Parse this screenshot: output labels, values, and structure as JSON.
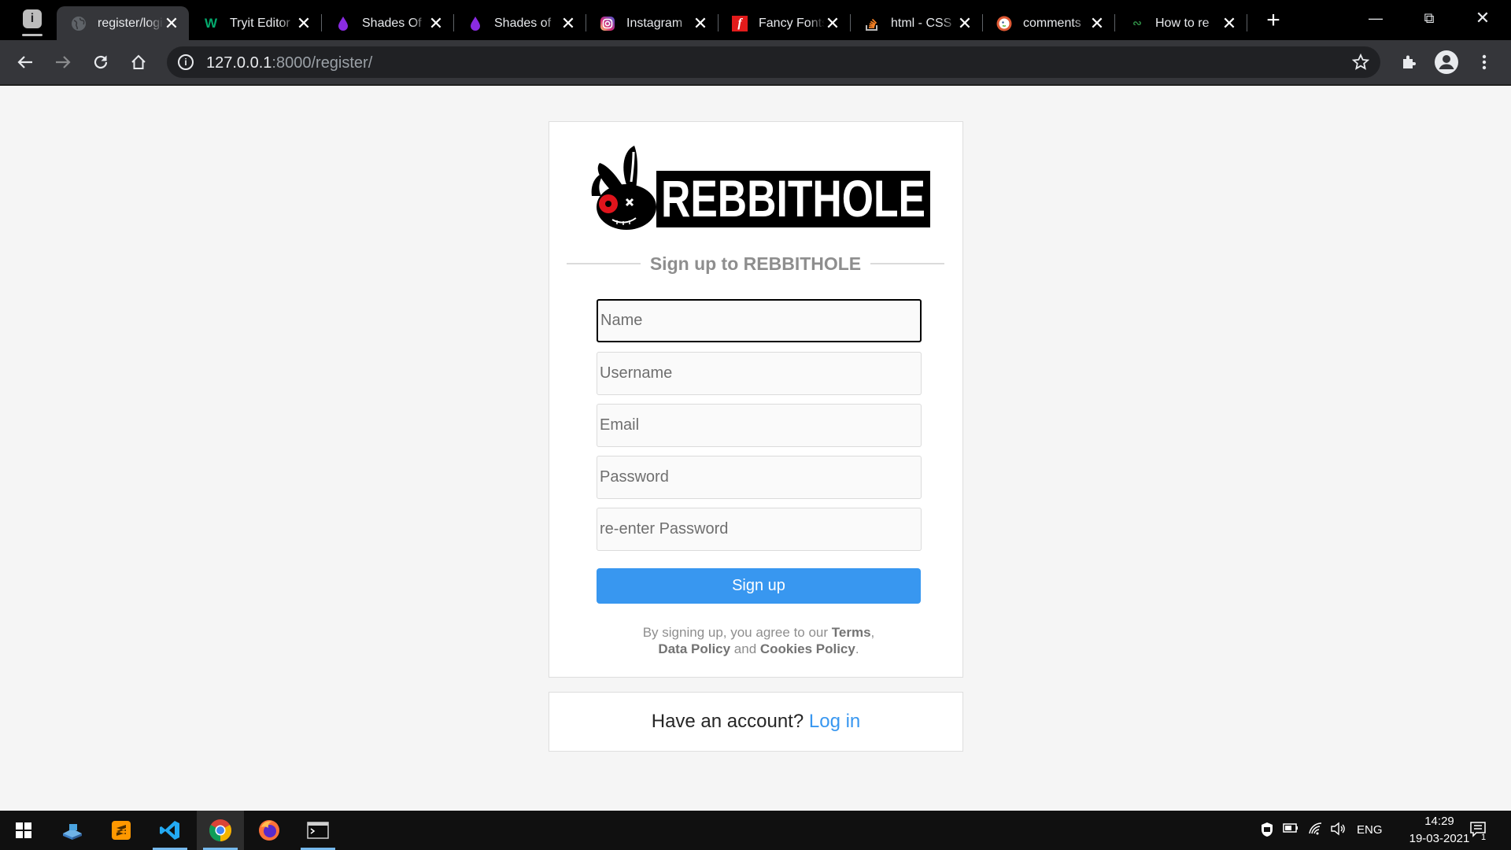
{
  "browser": {
    "tabs": [
      {
        "title": "register/login",
        "favicon": "globe-icon",
        "active": true
      },
      {
        "title": "Tryit Editor",
        "favicon": "w3schools-icon",
        "active": false
      },
      {
        "title": "Shades Of",
        "favicon": "purple-drop-icon",
        "active": false
      },
      {
        "title": "Shades of",
        "favicon": "purple-drop-icon",
        "active": false
      },
      {
        "title": "Instagram",
        "favicon": "instagram-icon",
        "active": false
      },
      {
        "title": "Fancy Fonts",
        "favicon": "fancy-f-icon",
        "active": false
      },
      {
        "title": "html - CSS",
        "favicon": "stackoverflow-icon",
        "active": false
      },
      {
        "title": "comments",
        "favicon": "duckduckgo-icon",
        "active": false
      },
      {
        "title": "How to re",
        "favicon": "geeksforgeeks-icon",
        "active": false
      }
    ],
    "close_glyph": "✕",
    "new_tab_glyph": "+",
    "url_host": "127.0.0.1",
    "url_path": ":8000/register/"
  },
  "page": {
    "logo_text": "REBBITHOLE",
    "heading": "Sign up to REBBITHOLE",
    "fields": {
      "name_placeholder": "Name",
      "username_placeholder": "Username",
      "email_placeholder": "Email",
      "password_placeholder": "Password",
      "repassword_placeholder": "re-enter Password"
    },
    "signup_label": "Sign up",
    "terms": {
      "prefix": "By signing up, you agree to our ",
      "terms": "Terms",
      "sep1": ",",
      "data_policy": "Data Policy",
      "and": " and ",
      "cookies_policy": "Cookies Policy",
      "end": "."
    },
    "login_prompt": "Have an account? ",
    "login_link": "Log in",
    "accent_color": "#3897f0"
  },
  "taskbar": {
    "apps": [
      "windows-start-icon",
      "file-explorer-icon",
      "sublime-text-icon",
      "vscode-icon",
      "chrome-icon",
      "firefox-icon",
      "terminal-icon"
    ],
    "language": "ENG",
    "time": "14:29",
    "date": "19-03-2021",
    "notification_count": "1"
  }
}
